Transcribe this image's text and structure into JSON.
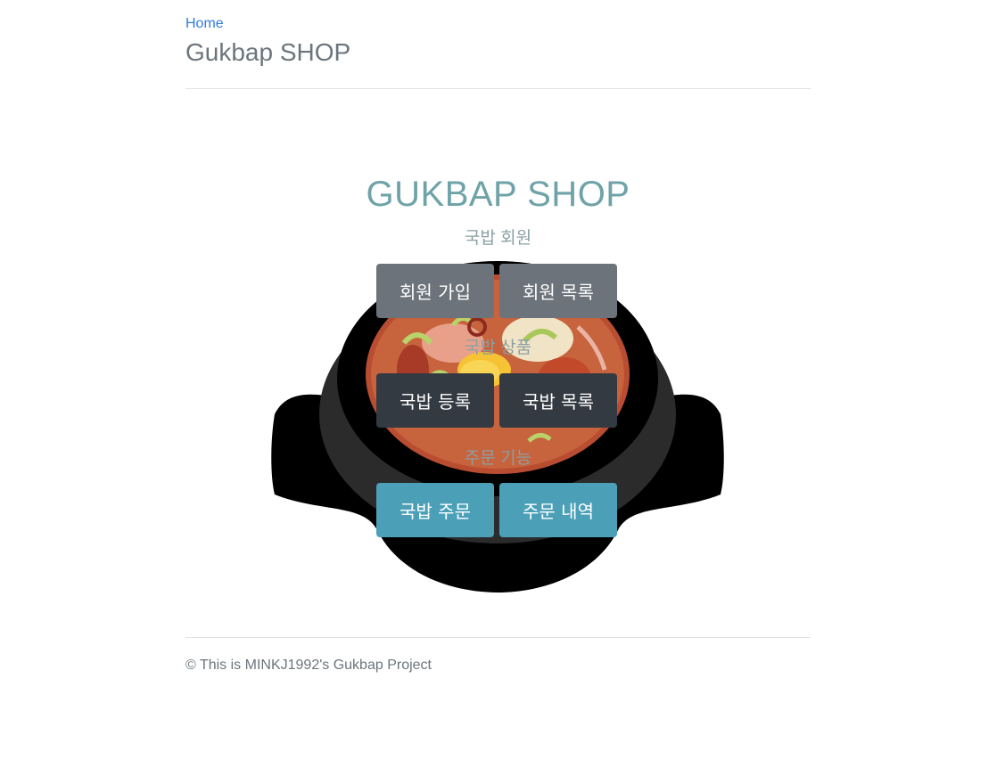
{
  "header": {
    "home_link": "Home",
    "site_title": "Gukbap SHOP"
  },
  "hero": {
    "title": "GUKBAP SHOP",
    "sections": [
      {
        "label": "국밥 회원",
        "buttons": [
          "회원 가입",
          "회원 목록"
        ]
      },
      {
        "label": "국밥 상품",
        "buttons": [
          "국밥 등록",
          "국밥 목록"
        ]
      },
      {
        "label": "주문 기능",
        "buttons": [
          "국밥 주문",
          "주문 내역"
        ]
      }
    ],
    "image": "gukbap-bowl-illustration"
  },
  "footer": {
    "text": "© This is MINKJ1992's Gukbap Project"
  },
  "colors": {
    "link": "#2f7cde",
    "hero_title": "#6fa3a8",
    "button_secondary": "#6d737b",
    "button_dark": "#343a42",
    "button_info": "#4ba0b8"
  }
}
